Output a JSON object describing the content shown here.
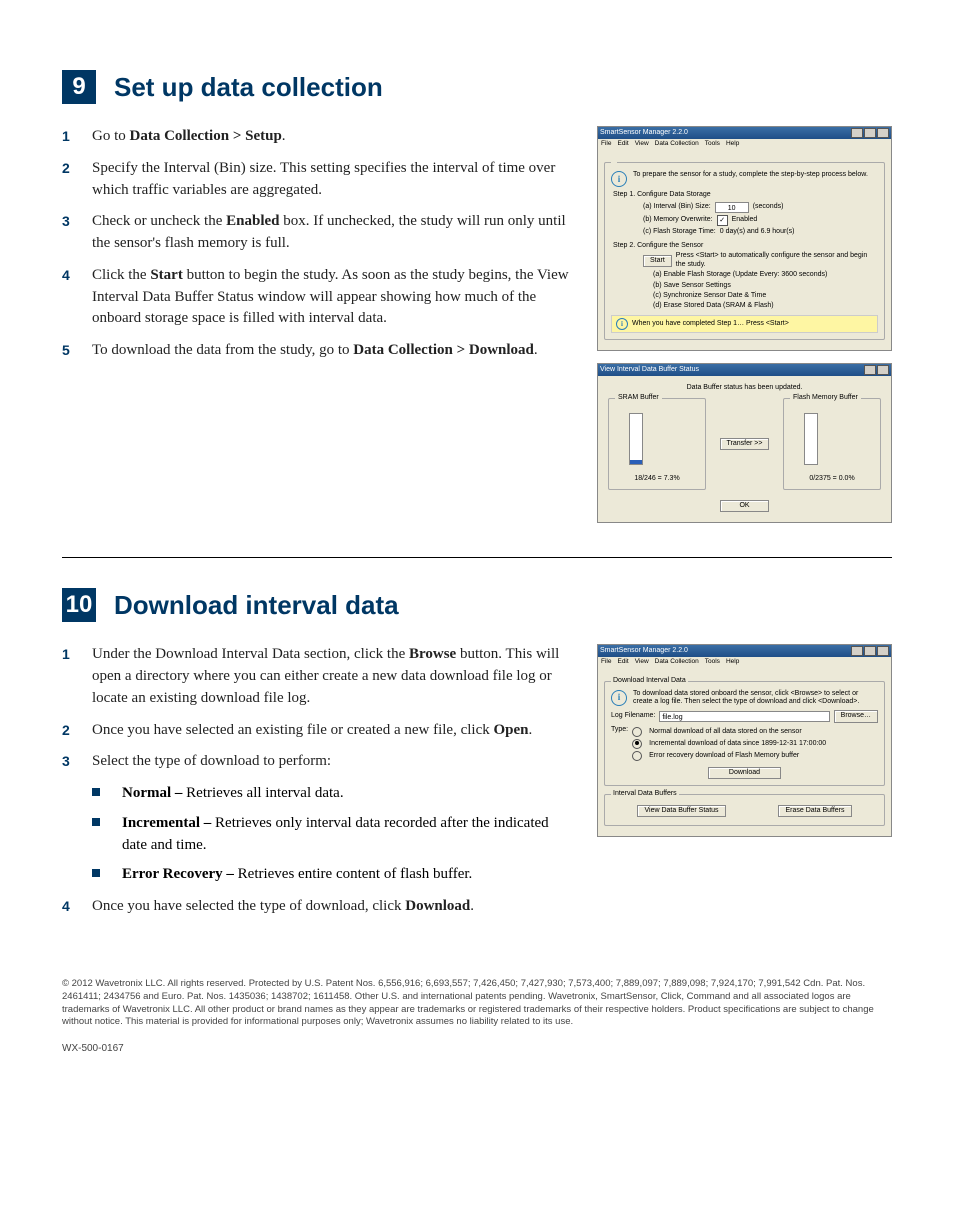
{
  "section9": {
    "number": "9",
    "title": "Set up data collection",
    "steps": [
      {
        "n": "1",
        "pre": "Go to ",
        "bold": "Data Collection > Setup",
        "post": "."
      },
      {
        "n": "2",
        "pre": "Specify the Interval (Bin) size. This setting specifies the interval of time over which traffic variables are aggregated.",
        "bold": "",
        "post": ""
      },
      {
        "n": "3",
        "pre": "Check or uncheck the ",
        "bold": "Enabled",
        "post": " box. If unchecked, the study will run only until the sensor's flash memory is full."
      },
      {
        "n": "4",
        "pre": "Click the ",
        "bold": "Start",
        "post": " button to begin the study. As soon as the study begins, the View Interval Data Buffer Status window will appear showing how much of the onboard storage space is filled with interval data."
      },
      {
        "n": "5",
        "pre": "To download the data from the study, go to ",
        "bold": "Data Collection > Download",
        "post": "."
      }
    ]
  },
  "win1": {
    "title": "SmartSensor Manager 2.2.0",
    "menus": [
      "File",
      "Edit",
      "View",
      "Data Collection",
      "Tools",
      "Help"
    ],
    "intro": "To prepare the sensor for a study, complete the step-by-step process below.",
    "step1_title": "Step 1. Configure Data Storage",
    "a_label": "(a) Interval (Bin) Size:",
    "a_value": "10",
    "a_unit": "(seconds)",
    "b_label": "(b) Memory Overwrite:",
    "b_checked": "Enabled",
    "c_label": "(c) Flash Storage Time:",
    "c_value": "0 day(s) and 6.9 hour(s)",
    "step2_title": "Step 2. Configure the Sensor",
    "start_btn": "Start",
    "start_hint": "Press <Start> to automatically configure the sensor and begin the study.",
    "sub_a": "(a) Enable Flash Storage (Update Every: 3600 seconds)",
    "sub_b": "(b) Save Sensor Settings",
    "sub_c": "(c) Synchronize Sensor Date & Time",
    "sub_d": "(d) Erase Stored Data (SRAM & Flash)",
    "hint": "When you have completed Step 1… Press <Start>"
  },
  "win2": {
    "title": "View Interval Data Buffer Status",
    "msg": "Data Buffer status has been updated.",
    "sram_label": "SRAM Buffer",
    "flash_label": "Flash Memory Buffer",
    "transfer_btn": "Transfer >>",
    "sram_pct": "18/246 = 7.3%",
    "flash_pct": "0/2375 = 0.0%",
    "ok_btn": "OK"
  },
  "section10": {
    "number": "10",
    "title": "Download interval data",
    "steps": [
      {
        "n": "1",
        "pre": "Under the Download Interval Data section, click the ",
        "bold": "Browse",
        "post": " button. This will open a directory where you can either create a new data download file log or locate an existing download file log."
      },
      {
        "n": "2",
        "pre": "Once you have selected an existing file or created a new file, click ",
        "bold": "Open",
        "post": "."
      },
      {
        "n": "3",
        "pre": "Select the type of download to perform:",
        "bold": "",
        "post": ""
      }
    ],
    "bullets": [
      {
        "bold": "Normal –",
        "post": " Retrieves all interval data."
      },
      {
        "bold": "Incremental –",
        "post": " Retrieves only interval data recorded after the indicated date and time."
      },
      {
        "bold": "Error Recovery –",
        "post": " Retrieves entire content of flash buffer."
      }
    ],
    "step4": {
      "n": "4",
      "pre": "Once you have selected the type of download, click ",
      "bold": "Download",
      "post": "."
    }
  },
  "win3": {
    "title": "SmartSensor Manager 2.2.0",
    "menus": [
      "File",
      "Edit",
      "View",
      "Data Collection",
      "Tools",
      "Help"
    ],
    "group1_title": "Download Interval Data",
    "intro": "To download data stored onboard the sensor, click <Browse> to select or create a log file. Then select the type of download and click <Download>.",
    "log_label": "Log Filename:",
    "log_value": "file.log",
    "browse_btn": "Browse…",
    "type_label": "Type:",
    "opt1": "Normal download of all data stored on the sensor",
    "opt2": "Incremental download of data since 1899-12-31 17:00:00",
    "opt3": "Error recovery download of Flash Memory buffer",
    "download_btn": "Download",
    "group2_title": "Interval Data Buffers",
    "view_btn": "View Data Buffer Status",
    "erase_btn": "Erase Data Buffers"
  },
  "footer": {
    "text": "© 2012 Wavetronix LLC. All rights reserved. Protected by U.S. Patent Nos. 6,556,916; 6,693,557; 7,426,450; 7,427,930; 7,573,400; 7,889,097; 7,889,098; 7,924,170; 7,991,542 Cdn. Pat. Nos. 2461411; 2434756 and Euro. Pat. Nos. 1435036; 1438702; 1611458. Other U.S. and international patents pending. Wavetronix, SmartSensor, Click, Command and all associated logos are trademarks of Wavetronix LLC. All other product or brand names as they appear are trademarks or registered trademarks of their respective holders. Product specifications are subject to change without notice. This material is provided for informational purposes only; Wavetronix assumes no liability related to its use.",
    "docid": "WX-500-0167"
  }
}
